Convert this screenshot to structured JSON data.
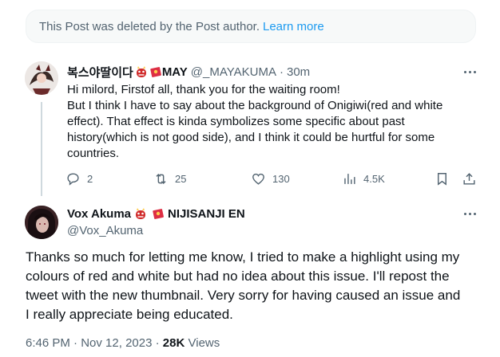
{
  "deleted_notice": {
    "text": "This Post was deleted by the Post author.",
    "link": "Learn more"
  },
  "reply": {
    "display_name": "복스야딸이다",
    "name_suffix": "MAY",
    "handle": "@_MAYAKUMA",
    "separator": "·",
    "time": "30m",
    "lines": [
      "Hi milord, Firstof all, thank you for the waiting room!",
      "But I think I have to say about the background of Onigiwi(red and white",
      "effect). That effect is kinda symbolizes some specific about past",
      "history(which is not good side), and I think it could be hurtful for some",
      "countries."
    ],
    "replies": "2",
    "reposts": "25",
    "likes": "130",
    "views": "4.5K"
  },
  "post": {
    "display_name": "Vox Akuma",
    "affiliation": "NIJISANJI EN",
    "handle": "@Vox_Akuma",
    "lines": [
      "Thanks so much for letting me know, I tried to make a highlight using my",
      "colours of red and white but had no idea about this issue. I'll repost the",
      "tweet with the new thumbnail. Very sorry for having caused an issue and",
      "I really appreciate being educated."
    ],
    "time": "6:46 PM",
    "separator": "·",
    "date": "Nov 12, 2023",
    "views_count": "28K",
    "views_label": "Views"
  },
  "icons": {
    "reply": "reply-icon",
    "repost": "repost-icon",
    "like": "heart-icon",
    "views": "views-icon",
    "bookmark": "bookmark-icon",
    "share": "share-icon",
    "more": "more-icon",
    "emoji_oni": "oni-emoji-icon",
    "emoji_envelope": "red-envelope-emoji-icon"
  },
  "colors": {
    "link": "#1d9bf0",
    "secondary_text": "#536471",
    "primary_text": "#0f1419"
  }
}
